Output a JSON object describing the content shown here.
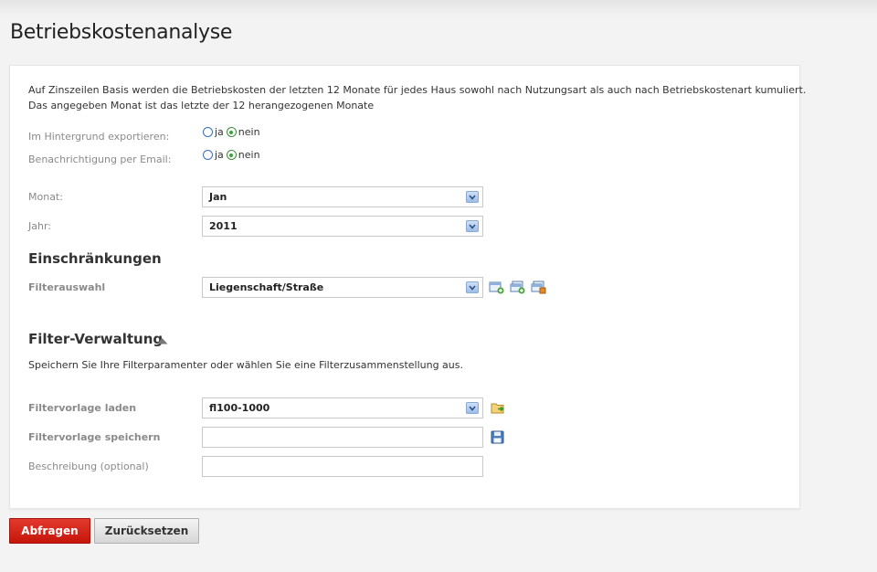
{
  "page": {
    "title": "Betriebskostenanalyse"
  },
  "intro": {
    "line1": "Auf Zinszeilen Basis werden die Betriebskosten der letzten 12 Monate für jedes Haus sowohl nach Nutzungsart als auch nach Betriebskostenart kumuliert.",
    "line2": "Das angegeben Monat ist das letzte der 12 herangezogenen Monate"
  },
  "options": {
    "export_background": {
      "label": "Im Hintergrund exportieren:",
      "yes": "ja",
      "no": "nein",
      "selected": "nein"
    },
    "email_notification": {
      "label": "Benachrichtigung per Email:",
      "yes": "ja",
      "no": "nein",
      "selected": "nein"
    }
  },
  "period": {
    "month": {
      "label": "Monat:",
      "value": "Jan"
    },
    "year": {
      "label": "Jahr:",
      "value": "2011"
    }
  },
  "restrictions": {
    "title": "Einschränkungen",
    "filter_label": "Filterauswahl",
    "filter_value": "Liegenschaft/Straße",
    "icons": [
      "add-filter-icon",
      "add-filter-group-icon",
      "delete-filter-group-icon"
    ]
  },
  "filter_management": {
    "title": "Filter-Verwaltung",
    "description": "Speichern Sie Ihre Filterparamenter oder wählen Sie eine Filterzusammenstellung aus.",
    "load_label": "Filtervorlage laden",
    "load_value": "fl100-1000",
    "save_label": "Filtervorlage speichern",
    "save_value": "",
    "desc_label": "Beschreibung (optional)",
    "desc_value": ""
  },
  "actions": {
    "submit": "Abfragen",
    "reset": "Zurücksetzen"
  },
  "colors": {
    "primary_button": "#d0261a",
    "accent_blue": "#3b6fb0",
    "radio_checked": "#3aa03a"
  }
}
